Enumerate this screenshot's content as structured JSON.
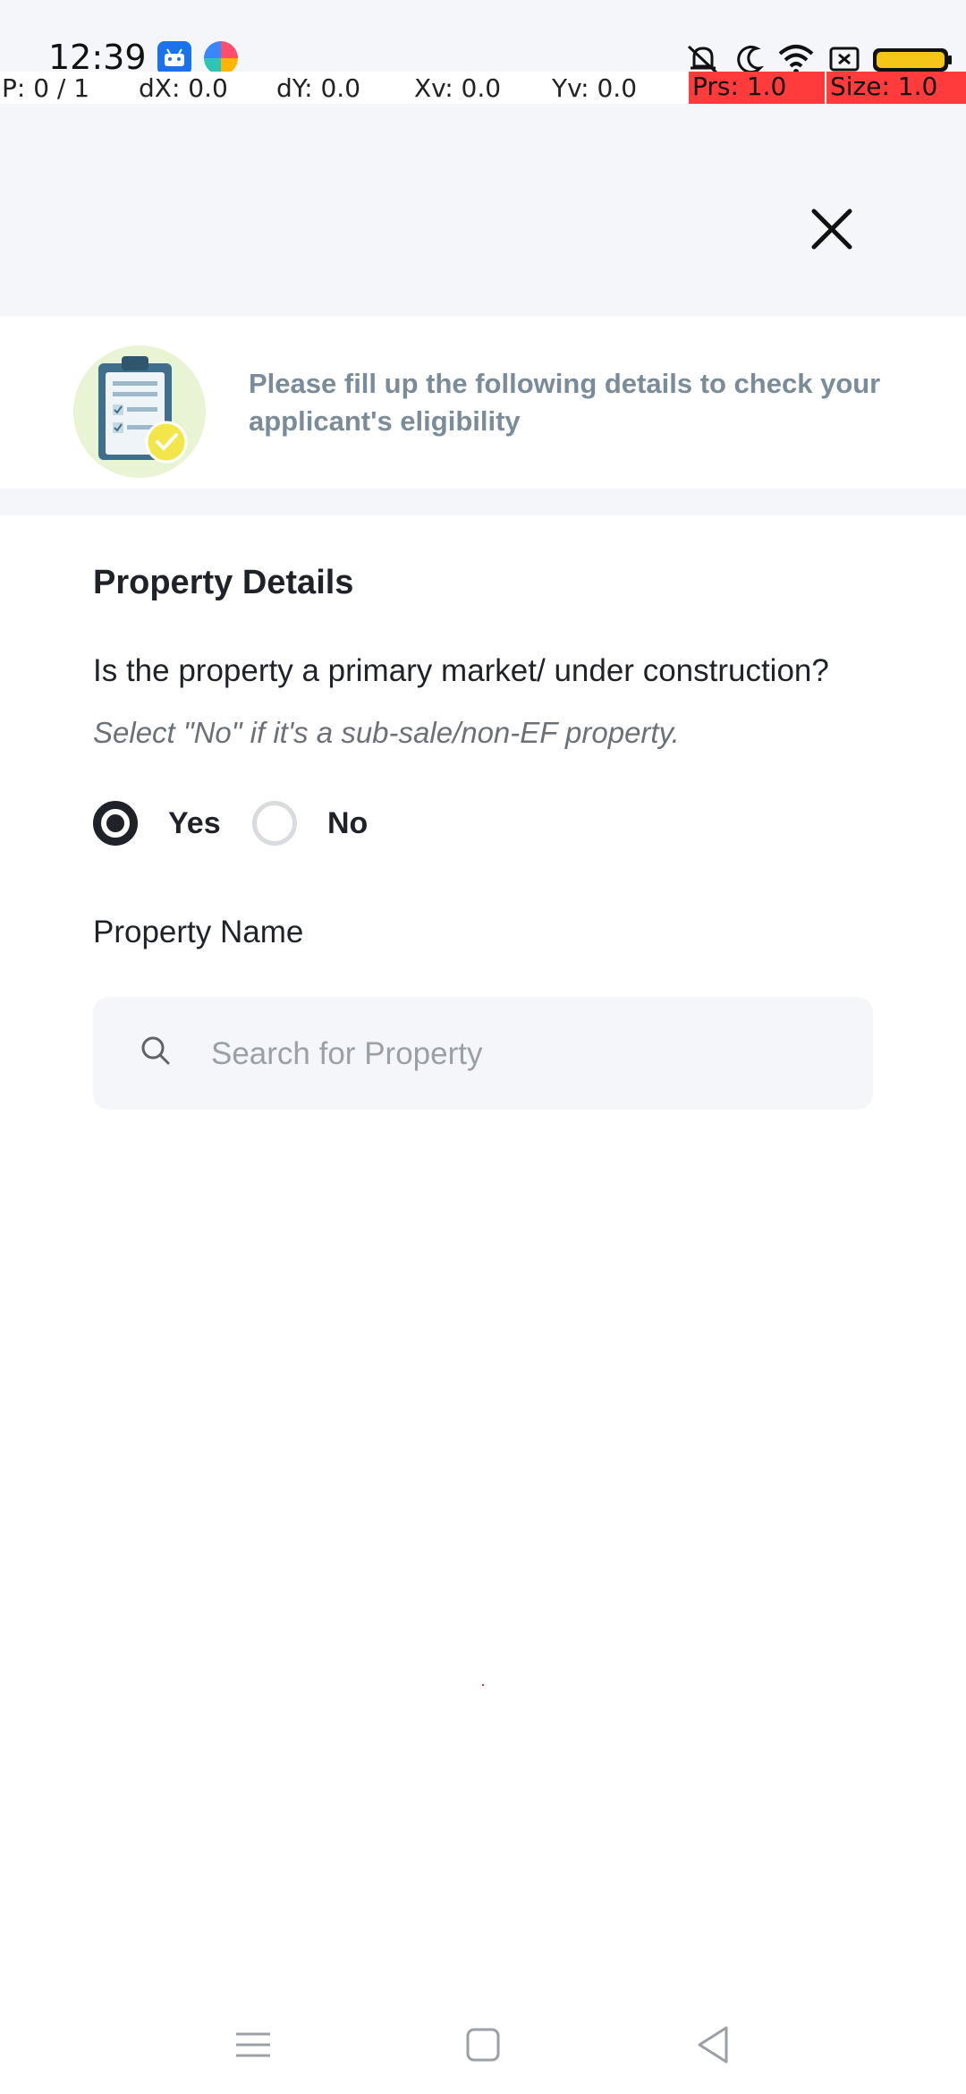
{
  "status_bar": {
    "time": "12:39",
    "left_icons": [
      "android-debug-icon",
      "browser-app-icon"
    ],
    "right_icons": [
      "muted-bell-icon",
      "moon-icon",
      "wifi-icon",
      "screen-record-icon",
      "battery-icon"
    ],
    "battery_color": "#f5c518"
  },
  "debug_overlay": {
    "p": "P: 0 / 1",
    "dx": "dX: 0.0",
    "dy": "dY: 0.0",
    "xv": "Xv: 0.0",
    "yv": "Yv: 0.0",
    "prs": "Prs: 1.0",
    "size": "Size: 1.0"
  },
  "header": {
    "close_icon": "close-icon"
  },
  "banner": {
    "icon": "clipboard-checklist-icon",
    "text": "Please fill up the following details to check your applicant's eligibility"
  },
  "form": {
    "section_title": "Property Details",
    "question": "Is the property a primary market/ under construction?",
    "hint": "Select \"No\" if it's a sub-sale/non-EF property.",
    "options": [
      {
        "label": "Yes",
        "selected": true
      },
      {
        "label": "No",
        "selected": false
      }
    ],
    "property_name_label": "Property Name",
    "search": {
      "placeholder": "Search for Property",
      "value": ""
    }
  },
  "nav_bar": {
    "buttons": [
      "menu-icon",
      "home-icon",
      "back-icon"
    ]
  },
  "colors": {
    "page_background": "#f5f6fa",
    "text_primary": "#1f2329",
    "banner_text": "#7a8c99",
    "debug_highlight": "#ff3b3b"
  }
}
